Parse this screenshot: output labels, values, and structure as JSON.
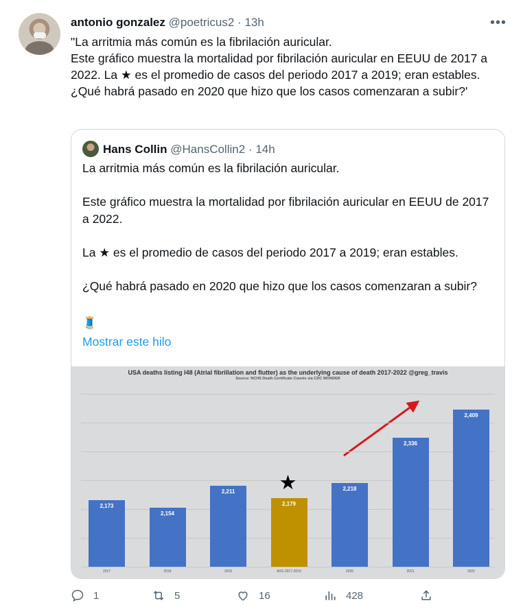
{
  "tweet": {
    "author_name": "antonio gonzalez",
    "handle": "@poetricus2",
    "time": "13h",
    "more_label": "•••",
    "text": "\"La arritmia más común es la fibrilación auricular.\nEste gráfico muestra la mortalidad por fibrilación auricular en EEUU de 2017 a 2022. La ★ es el promedio de casos del periodo 2017 a 2019; eran estables.\n¿Qué habrá pasado en 2020 que hizo que los casos comenzaran a subir?'"
  },
  "quote": {
    "author_name": "Hans Collin",
    "handle": "@HansCollin2",
    "time": "14h",
    "text": "La arritmia más común es la fibrilación auricular.\n\nEste gráfico muestra la mortalidad por fibrilación auricular en EEUU de 2017 a 2022.\n\nLa ★ es el promedio de casos del periodo 2017 a 2019; eran estables.\n\n¿Qué habrá pasado en 2020 que hizo que los casos comenzaran a subir?",
    "spool_emoji": "🧵",
    "show_thread": "Mostrar este hilo"
  },
  "chart_data": {
    "type": "bar",
    "title": "USA deaths listing I48 (Atrial fibrillation and flutter) as the underlying cause of death 2017-2022 @greg_travis",
    "subtitle": "Source: NCHS Death Certificate Counts via CDC WONDER",
    "categories": [
      "2017",
      "2018",
      "2019",
      "AVG 2017-2019",
      "2020",
      "2021",
      "2022"
    ],
    "values": [
      2173,
      2154,
      2211,
      2179,
      2218,
      2336,
      2409
    ],
    "value_labels": [
      "2,173",
      "2,154",
      "2,211",
      "2,179",
      "2,218",
      "2,336",
      "2,409"
    ],
    "colors": [
      "#4472c4",
      "#4472c4",
      "#4472c4",
      "#bf9000",
      "#4472c4",
      "#4472c4",
      "#4472c4"
    ],
    "star_marker": "★",
    "ylim": [
      2000,
      2450
    ],
    "grid": true
  },
  "actions": {
    "reply_count": "1",
    "retweet_count": "5",
    "like_count": "16",
    "view_count": "428"
  },
  "colors": {
    "link": "#1d9bf0",
    "muted": "#536471"
  }
}
